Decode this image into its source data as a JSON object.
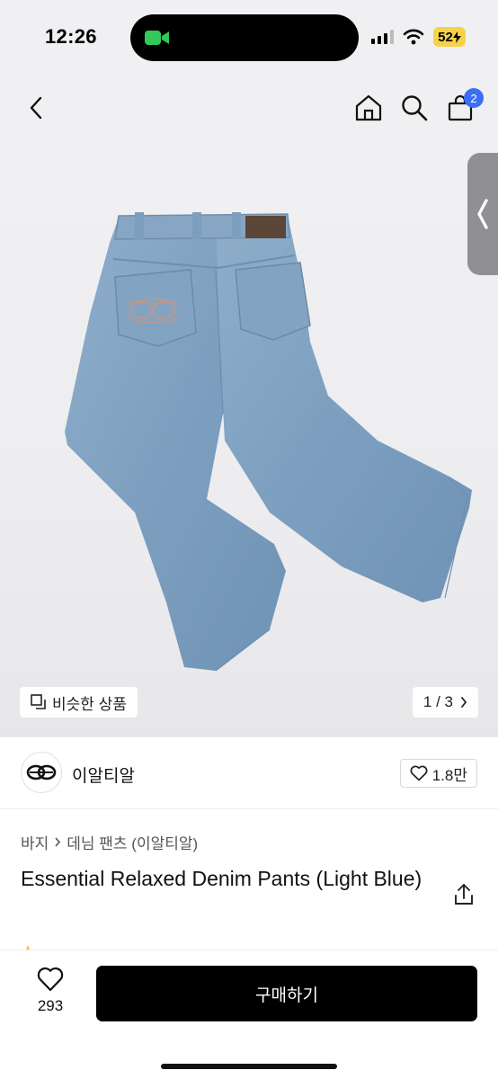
{
  "status_bar": {
    "time": "12:26",
    "battery": "52",
    "camera_icon": "video-camera-icon",
    "accent_green": "#34c759"
  },
  "header": {
    "back_icon": "chevron-left-icon",
    "home_icon": "home-icon",
    "search_icon": "search-icon",
    "cart_icon": "shopping-bag-icon",
    "cart_count": "2",
    "badge_color": "#3b6ff5"
  },
  "gallery": {
    "similar_label": "비슷한 상품",
    "pager": "1 / 3",
    "image_subject": "jeans-photo"
  },
  "seller": {
    "name": "이알티알",
    "like_count": "1.8만"
  },
  "breadcrumb": {
    "category": "바지",
    "subcategory": "데님 팬츠 (이알티알)"
  },
  "product": {
    "title": "Essential Relaxed Denim Pants (Light Blue)"
  },
  "bottom_bar": {
    "wish_count": "293",
    "buy_label": "구매하기"
  }
}
